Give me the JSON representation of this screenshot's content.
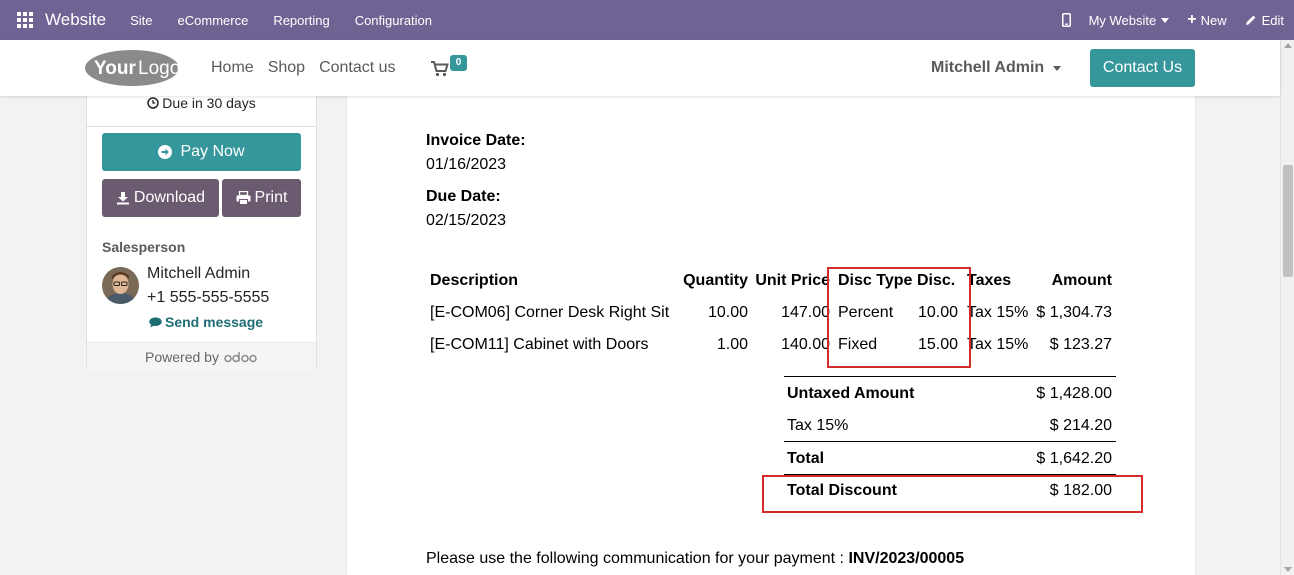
{
  "topbar": {
    "brand": "Website",
    "menu": [
      "Site",
      "eCommerce",
      "Reporting",
      "Configuration"
    ],
    "my_website": "My Website",
    "new": "New",
    "edit": "Edit"
  },
  "header": {
    "nav": [
      "Home",
      "Shop",
      "Contact us"
    ],
    "cart_count": "0",
    "user": "Mitchell Admin",
    "contact_button": "Contact Us"
  },
  "sidebar": {
    "due": "Due in 30 days",
    "pay_now": "Pay Now",
    "download": "Download",
    "print": "Print",
    "salesperson_label": "Salesperson",
    "salesperson_name": "Mitchell Admin",
    "salesperson_phone": "+1 555-555-5555",
    "send_message": "Send message",
    "powered_by": "Powered by"
  },
  "invoice": {
    "invoice_date_label": "Invoice Date:",
    "invoice_date": "01/16/2023",
    "due_date_label": "Due Date:",
    "due_date": "02/15/2023",
    "columns": {
      "description": "Description",
      "quantity": "Quantity",
      "unit_price": "Unit Price",
      "disc_type": "Disc Type",
      "disc": "Disc.",
      "taxes": "Taxes",
      "amount": "Amount"
    },
    "lines": [
      {
        "description": "[E-COM06] Corner Desk Right Sit",
        "quantity": "10.00",
        "unit_price": "147.00",
        "disc_type": "Percent",
        "disc": "10.00",
        "taxes": "Tax 15%",
        "amount": "$ 1,304.73"
      },
      {
        "description": "[E-COM11] Cabinet with Doors",
        "quantity": "1.00",
        "unit_price": "140.00",
        "disc_type": "Fixed",
        "disc": "15.00",
        "taxes": "Tax 15%",
        "amount": "$ 123.27"
      }
    ],
    "totals": {
      "untaxed_label": "Untaxed Amount",
      "untaxed": "$ 1,428.00",
      "tax_label": "Tax 15%",
      "tax": "$ 214.20",
      "total_label": "Total",
      "total": "$ 1,642.20",
      "discount_label": "Total Discount",
      "discount": "$ 182.00"
    },
    "communication_text": "Please use the following communication for your payment :",
    "communication_ref": "INV/2023/00005"
  },
  "colors": {
    "topbar": "#6f6394",
    "accent": "#35979c",
    "secondary": "#6b5b70",
    "highlight": "#d42a2a"
  }
}
